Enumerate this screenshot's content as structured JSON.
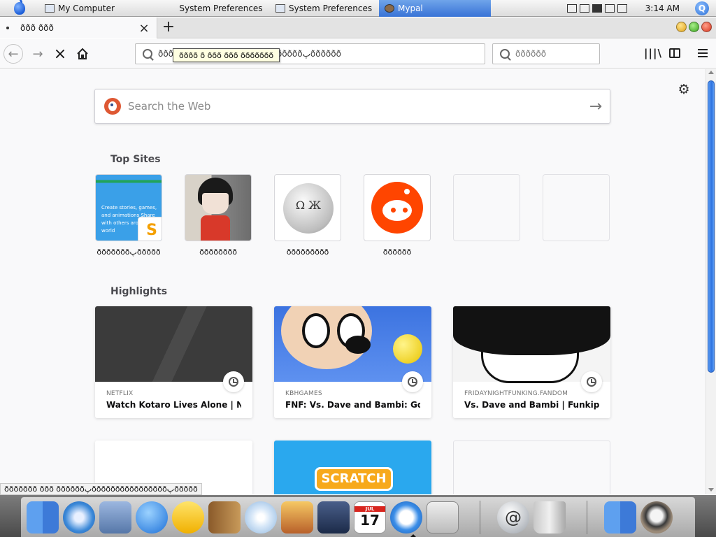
{
  "menubar": {
    "tasks": [
      "My Computer",
      "System Preferences",
      "System Preferences",
      "Mypal"
    ],
    "clock": "3:14 AM"
  },
  "browser": {
    "tab_title": "ððð ððð",
    "url_text": "ððððð ð ððð ððð ðððððððپ ðððððپðððððð",
    "search_placeholder": "ðððððð",
    "tooltip": "ðððð ð ððð ððð ððððððð"
  },
  "newtab": {
    "search_placeholder": "Search the Web",
    "topsites_title": "Top Sites",
    "highlights_title": "Highlights",
    "topsites": [
      {
        "label": "ðððððððپððððð"
      },
      {
        "label": "ðððððððð"
      },
      {
        "label": "ððððððððð"
      },
      {
        "label": "ðððððð"
      }
    ],
    "tile1_text": "Create stories, games, and animations Share with others around the world",
    "tile1_badge": "S",
    "highlights": [
      {
        "host": "NETFLIX",
        "title": "Watch Kotaro Lives Alone | Netf..."
      },
      {
        "host": "KBHGAMES",
        "title": "FNF: Vs. Dave and Bambi: Golde..."
      },
      {
        "host": "FRIDAYNIGHTFUNKING.FANDOM",
        "title": "Vs. Dave and Bambi | Funkipedia..."
      }
    ],
    "scratch_logo": "SCRATCH"
  },
  "statusbar": "ððððððð ððð ððððððپððððððððððððððððپððððð",
  "dock": {
    "ical_month": "JUL",
    "ical_day": "17",
    "mailbox_glyph": "@"
  }
}
